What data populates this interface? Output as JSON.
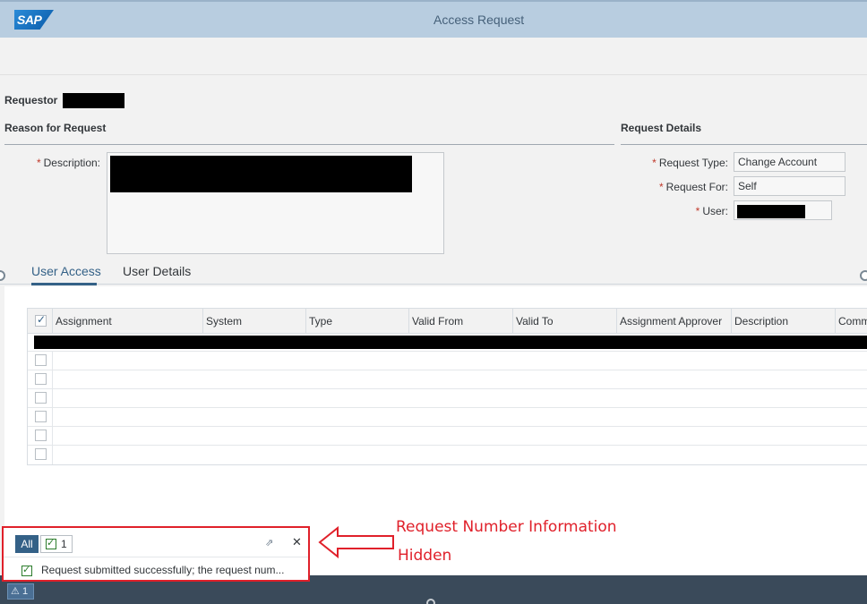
{
  "shell": {
    "logo": "SAP",
    "title": "Access Request"
  },
  "requestor": {
    "label": "Requestor"
  },
  "reason": {
    "section_title": "Reason for Request",
    "description_label": "Description:"
  },
  "request_details": {
    "section_title": "Request Details",
    "request_type_label": "Request Type:",
    "request_type_value": "Change Account",
    "request_for_label": "Request For:",
    "request_for_value": "Self",
    "user_label": "User:"
  },
  "tabs": [
    {
      "label": "User Access",
      "active": true
    },
    {
      "label": "User Details",
      "active": false
    }
  ],
  "table": {
    "columns": [
      "Assignment",
      "System",
      "Type",
      "Valid From",
      "Valid To",
      "Assignment Approver",
      "Description",
      "Comm"
    ]
  },
  "messages": {
    "all_label": "All",
    "success_count": "1",
    "message_text": "Request submitted successfully; the request num...",
    "footer_count": "1"
  },
  "annotation": {
    "line1": "Request Number Information",
    "line2": "Hidden"
  },
  "colors": {
    "brand": "#346187",
    "header": "#b8cde0",
    "annotation": "#e0202a",
    "success": "#2b7c2b"
  }
}
